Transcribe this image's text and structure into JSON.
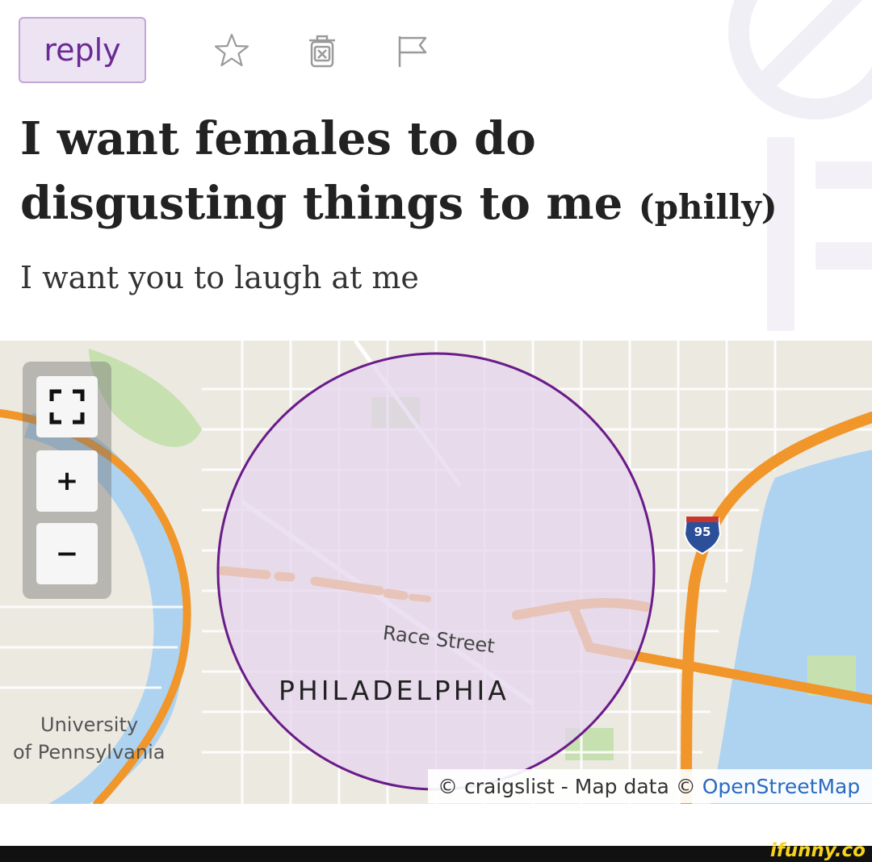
{
  "toolbar": {
    "reply_label": "reply",
    "icons": [
      "star-icon",
      "trash-icon",
      "flag-icon"
    ]
  },
  "post": {
    "title": "I want females to do disgusting things to me",
    "location": "(philly)",
    "body": "I want you to laugh at me"
  },
  "map": {
    "controls": {
      "fullscreen": "fullscreen-icon",
      "zoom_in": "+",
      "zoom_out": "−"
    },
    "labels": {
      "city": "PHILADELPHIA",
      "street": "Race Street",
      "university_line1": "University",
      "university_line2": "of Pennsylvania"
    },
    "highway_shield": "95",
    "attribution": {
      "prefix": "© craigslist - Map data ©",
      "link": "OpenStreetMap"
    }
  },
  "footer": {
    "watermark": "ifunny.co"
  },
  "colors": {
    "reply_bg": "#ece3f3",
    "reply_text": "#6a2a96",
    "circle_fill": "#e4d4ef",
    "circle_stroke": "#6a1b8a",
    "highway": "#f0962a",
    "water": "#aed3f0",
    "park": "#c6e0b0"
  }
}
